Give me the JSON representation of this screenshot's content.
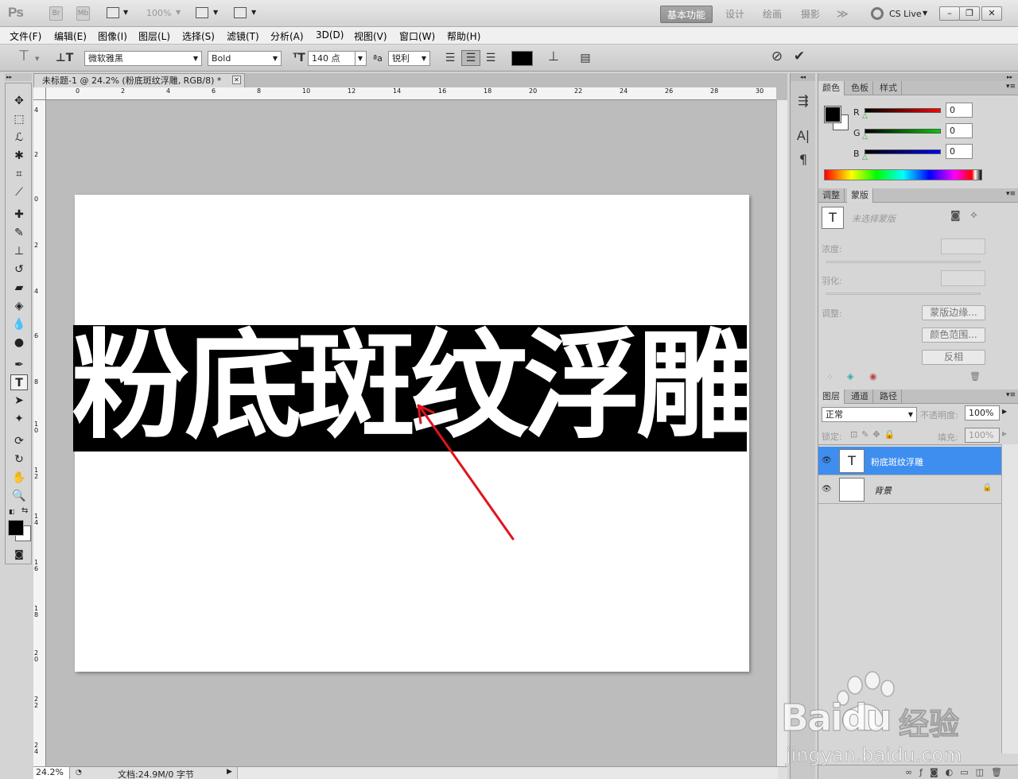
{
  "titlebar": {
    "logo": "Ps",
    "br": "Br",
    "mb": "Mb",
    "zoom": "100%",
    "workspaces": [
      "基本功能",
      "设计",
      "绘画",
      "摄影"
    ],
    "more": "≫",
    "cslive": "CS Live"
  },
  "menu": [
    "文件(F)",
    "编辑(E)",
    "图像(I)",
    "图层(L)",
    "选择(S)",
    "滤镜(T)",
    "分析(A)",
    "3D(D)",
    "视图(V)",
    "窗口(W)",
    "帮助(H)"
  ],
  "options": {
    "font_family": "微软雅黑",
    "font_style": "Bold",
    "font_size": "140 点",
    "aa_label": "ªa",
    "antialias": "锐利",
    "text_color": "#000000"
  },
  "document": {
    "tab_title": "未标题-1 @ 24.2% (粉底斑纹浮雕, RGB/8) *",
    "text": "粉底斑纹浮雕",
    "ruler_h": [
      "0",
      "2",
      "4",
      "6",
      "8",
      "10",
      "12",
      "14",
      "16",
      "18",
      "20",
      "22",
      "24",
      "26",
      "28",
      "30"
    ],
    "ruler_v": [
      "4",
      "2",
      "0",
      "2",
      "4",
      "6",
      "8",
      "1\n0",
      "1\n2",
      "1\n4",
      "1\n6",
      "1\n8",
      "2\n0",
      "2\n2",
      "2\n4"
    ]
  },
  "status": {
    "zoom": "24.2%",
    "doc_info": "文档:24.9M/0 字节"
  },
  "color_panel": {
    "tabs": [
      "颜色",
      "色板",
      "样式"
    ],
    "channels": [
      {
        "label": "R",
        "value": "0",
        "color": "#e00000"
      },
      {
        "label": "G",
        "value": "0",
        "color": "#00b000"
      },
      {
        "label": "B",
        "value": "0",
        "color": "#0000d0"
      }
    ]
  },
  "mask_panel": {
    "tabs": [
      "调整",
      "蒙版"
    ],
    "no_mask": "未选择蒙版",
    "density": "浓度:",
    "feather": "羽化:",
    "adjust": "调整:",
    "btn_edge": "蒙版边缘...",
    "btn_range": "颜色范围...",
    "btn_invert": "反相"
  },
  "layers_panel": {
    "tabs": [
      "图层",
      "通道",
      "路径"
    ],
    "blend_mode": "正常",
    "opacity_label": "不透明度:",
    "opacity": "100%",
    "lock_label": "锁定:",
    "fill_label": "填充:",
    "fill": "100%",
    "layers": [
      {
        "name": "粉底斑纹浮雕",
        "thumb": "T",
        "selected": true
      },
      {
        "name": "背景",
        "thumb": "",
        "selected": false
      }
    ]
  },
  "watermark": {
    "brand": "Baidu",
    "cn": "经验",
    "url": "jingyan.baidu.com"
  }
}
